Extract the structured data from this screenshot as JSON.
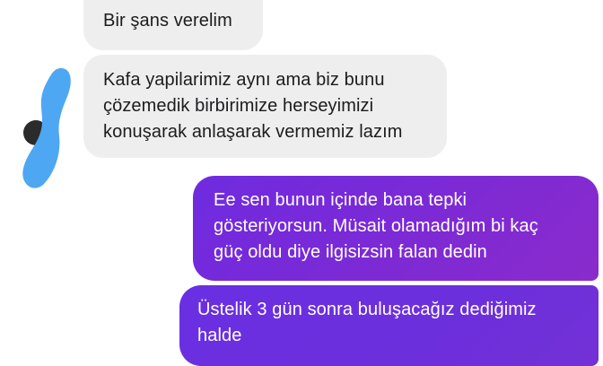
{
  "conversation": {
    "incoming": [
      {
        "lines": [
          "Bir şans verelim"
        ]
      },
      {
        "lines": [
          "Kafa yapilarimiz aynı ama biz bunu",
          "çözemedik birbirimize herseyimizi",
          "konuşarak anlaşarak vermemiz lazım"
        ]
      }
    ],
    "outgoing": [
      {
        "lines": [
          "Ee sen bunun içinde bana tepki",
          "gösteriyorsun. Müsait olamadığım bi kaç",
          "güç oldu diye ilgisizsin falan dedin"
        ]
      },
      {
        "lines": [
          "Üstelik 3 gün sonra buluşacağız dediğimiz",
          "halde"
        ]
      }
    ]
  },
  "colors": {
    "incoming_bubble": "#eeeeef",
    "outgoing_bubble": "#7a2ad6",
    "redaction_mark": "#4ea7f2"
  },
  "icons": {
    "avatar": "avatar-icon",
    "redaction": "blue-scribble-redaction"
  }
}
